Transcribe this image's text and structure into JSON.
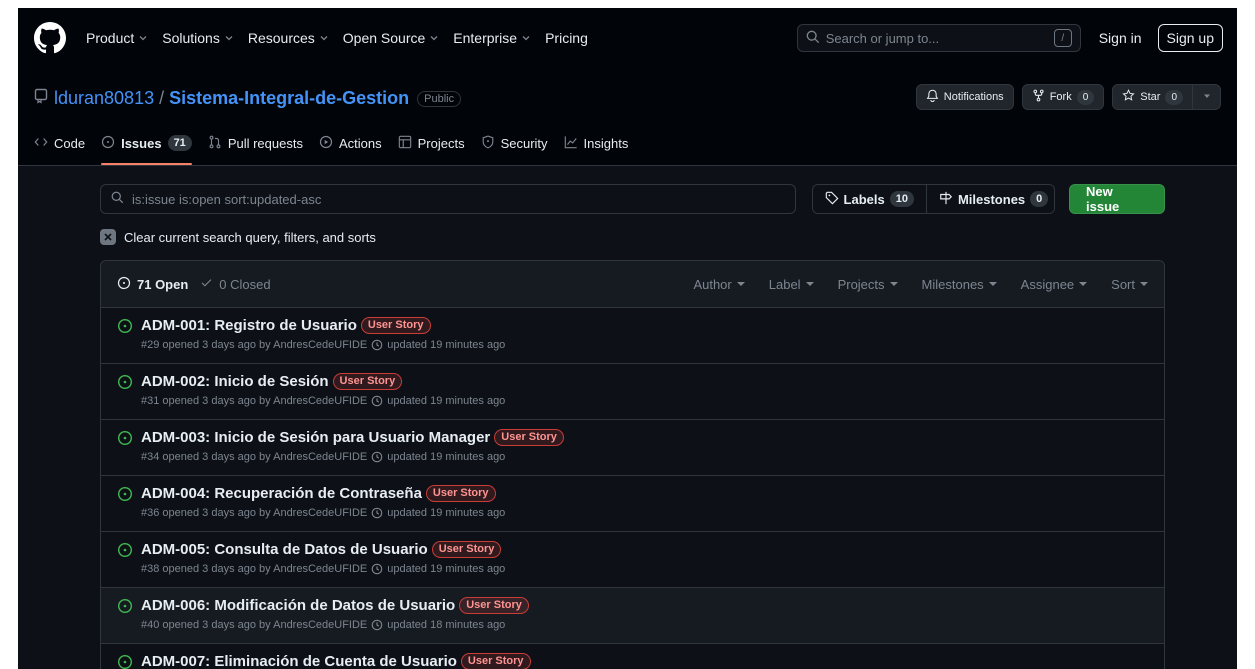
{
  "header": {
    "nav": [
      {
        "label": "Product",
        "dropdown": true
      },
      {
        "label": "Solutions",
        "dropdown": true
      },
      {
        "label": "Resources",
        "dropdown": true
      },
      {
        "label": "Open Source",
        "dropdown": true
      },
      {
        "label": "Enterprise",
        "dropdown": true
      },
      {
        "label": "Pricing",
        "dropdown": false
      }
    ],
    "search_placeholder": "Search or jump to...",
    "search_key": "/",
    "sign_in": "Sign in",
    "sign_up": "Sign up"
  },
  "repo": {
    "owner": "lduran80813",
    "separator": "/",
    "name": "Sistema-Integral-de-Gestion",
    "visibility": "Public",
    "notifications": "Notifications",
    "fork_label": "Fork",
    "fork_count": "0",
    "star_label": "Star",
    "star_count": "0"
  },
  "tabs": [
    {
      "label": "Code",
      "icon": "code-icon"
    },
    {
      "label": "Issues",
      "icon": "issue-opened-icon",
      "count": "71",
      "active": true
    },
    {
      "label": "Pull requests",
      "icon": "git-pull-request-icon"
    },
    {
      "label": "Actions",
      "icon": "play-icon"
    },
    {
      "label": "Projects",
      "icon": "table-icon"
    },
    {
      "label": "Security",
      "icon": "shield-icon"
    },
    {
      "label": "Insights",
      "icon": "graph-icon"
    }
  ],
  "filters": {
    "query": "is:issue is:open sort:updated-asc",
    "labels_label": "Labels",
    "labels_count": "10",
    "milestones_label": "Milestones",
    "milestones_count": "0",
    "new_issue": "New issue",
    "clear_text": "Clear current search query, filters, and sorts"
  },
  "issue_list": {
    "open_label": "71 Open",
    "closed_label": "0 Closed",
    "head_filters": [
      "Author",
      "Label",
      "Projects",
      "Milestones",
      "Assignee",
      "Sort"
    ],
    "issues": [
      {
        "title": "ADM-001: Registro de Usuario",
        "label": "User Story",
        "meta": "#29 opened 3 days ago by AndresCedeUFIDE",
        "updated": "updated 19 minutes ago"
      },
      {
        "title": "ADM-002: Inicio de Sesión",
        "label": "User Story",
        "meta": "#31 opened 3 days ago by AndresCedeUFIDE",
        "updated": "updated 19 minutes ago"
      },
      {
        "title": "ADM-003: Inicio de Sesión para Usuario Manager",
        "label": "User Story",
        "meta": "#34 opened 3 days ago by AndresCedeUFIDE",
        "updated": "updated 19 minutes ago"
      },
      {
        "title": "ADM-004: Recuperación de Contraseña",
        "label": "User Story",
        "meta": "#36 opened 3 days ago by AndresCedeUFIDE",
        "updated": "updated 19 minutes ago"
      },
      {
        "title": "ADM-005: Consulta de Datos de Usuario",
        "label": "User Story",
        "meta": "#38 opened 3 days ago by AndresCedeUFIDE",
        "updated": "updated 19 minutes ago"
      },
      {
        "title": "ADM-006: Modificación de Datos de Usuario",
        "label": "User Story",
        "meta": "#40 opened 3 days ago by AndresCedeUFIDE",
        "updated": "updated 18 minutes ago"
      },
      {
        "title": "ADM-007: Eliminación de Cuenta de Usuario",
        "label": "User Story",
        "meta": "",
        "updated": ""
      }
    ]
  },
  "colors": {
    "background": "#0d1117",
    "header": "#010409",
    "link": "#4493f8",
    "open_green": "#3fb950",
    "new_issue_green": "#238636",
    "label_red": "#f85149",
    "active_tab": "#f78166"
  }
}
